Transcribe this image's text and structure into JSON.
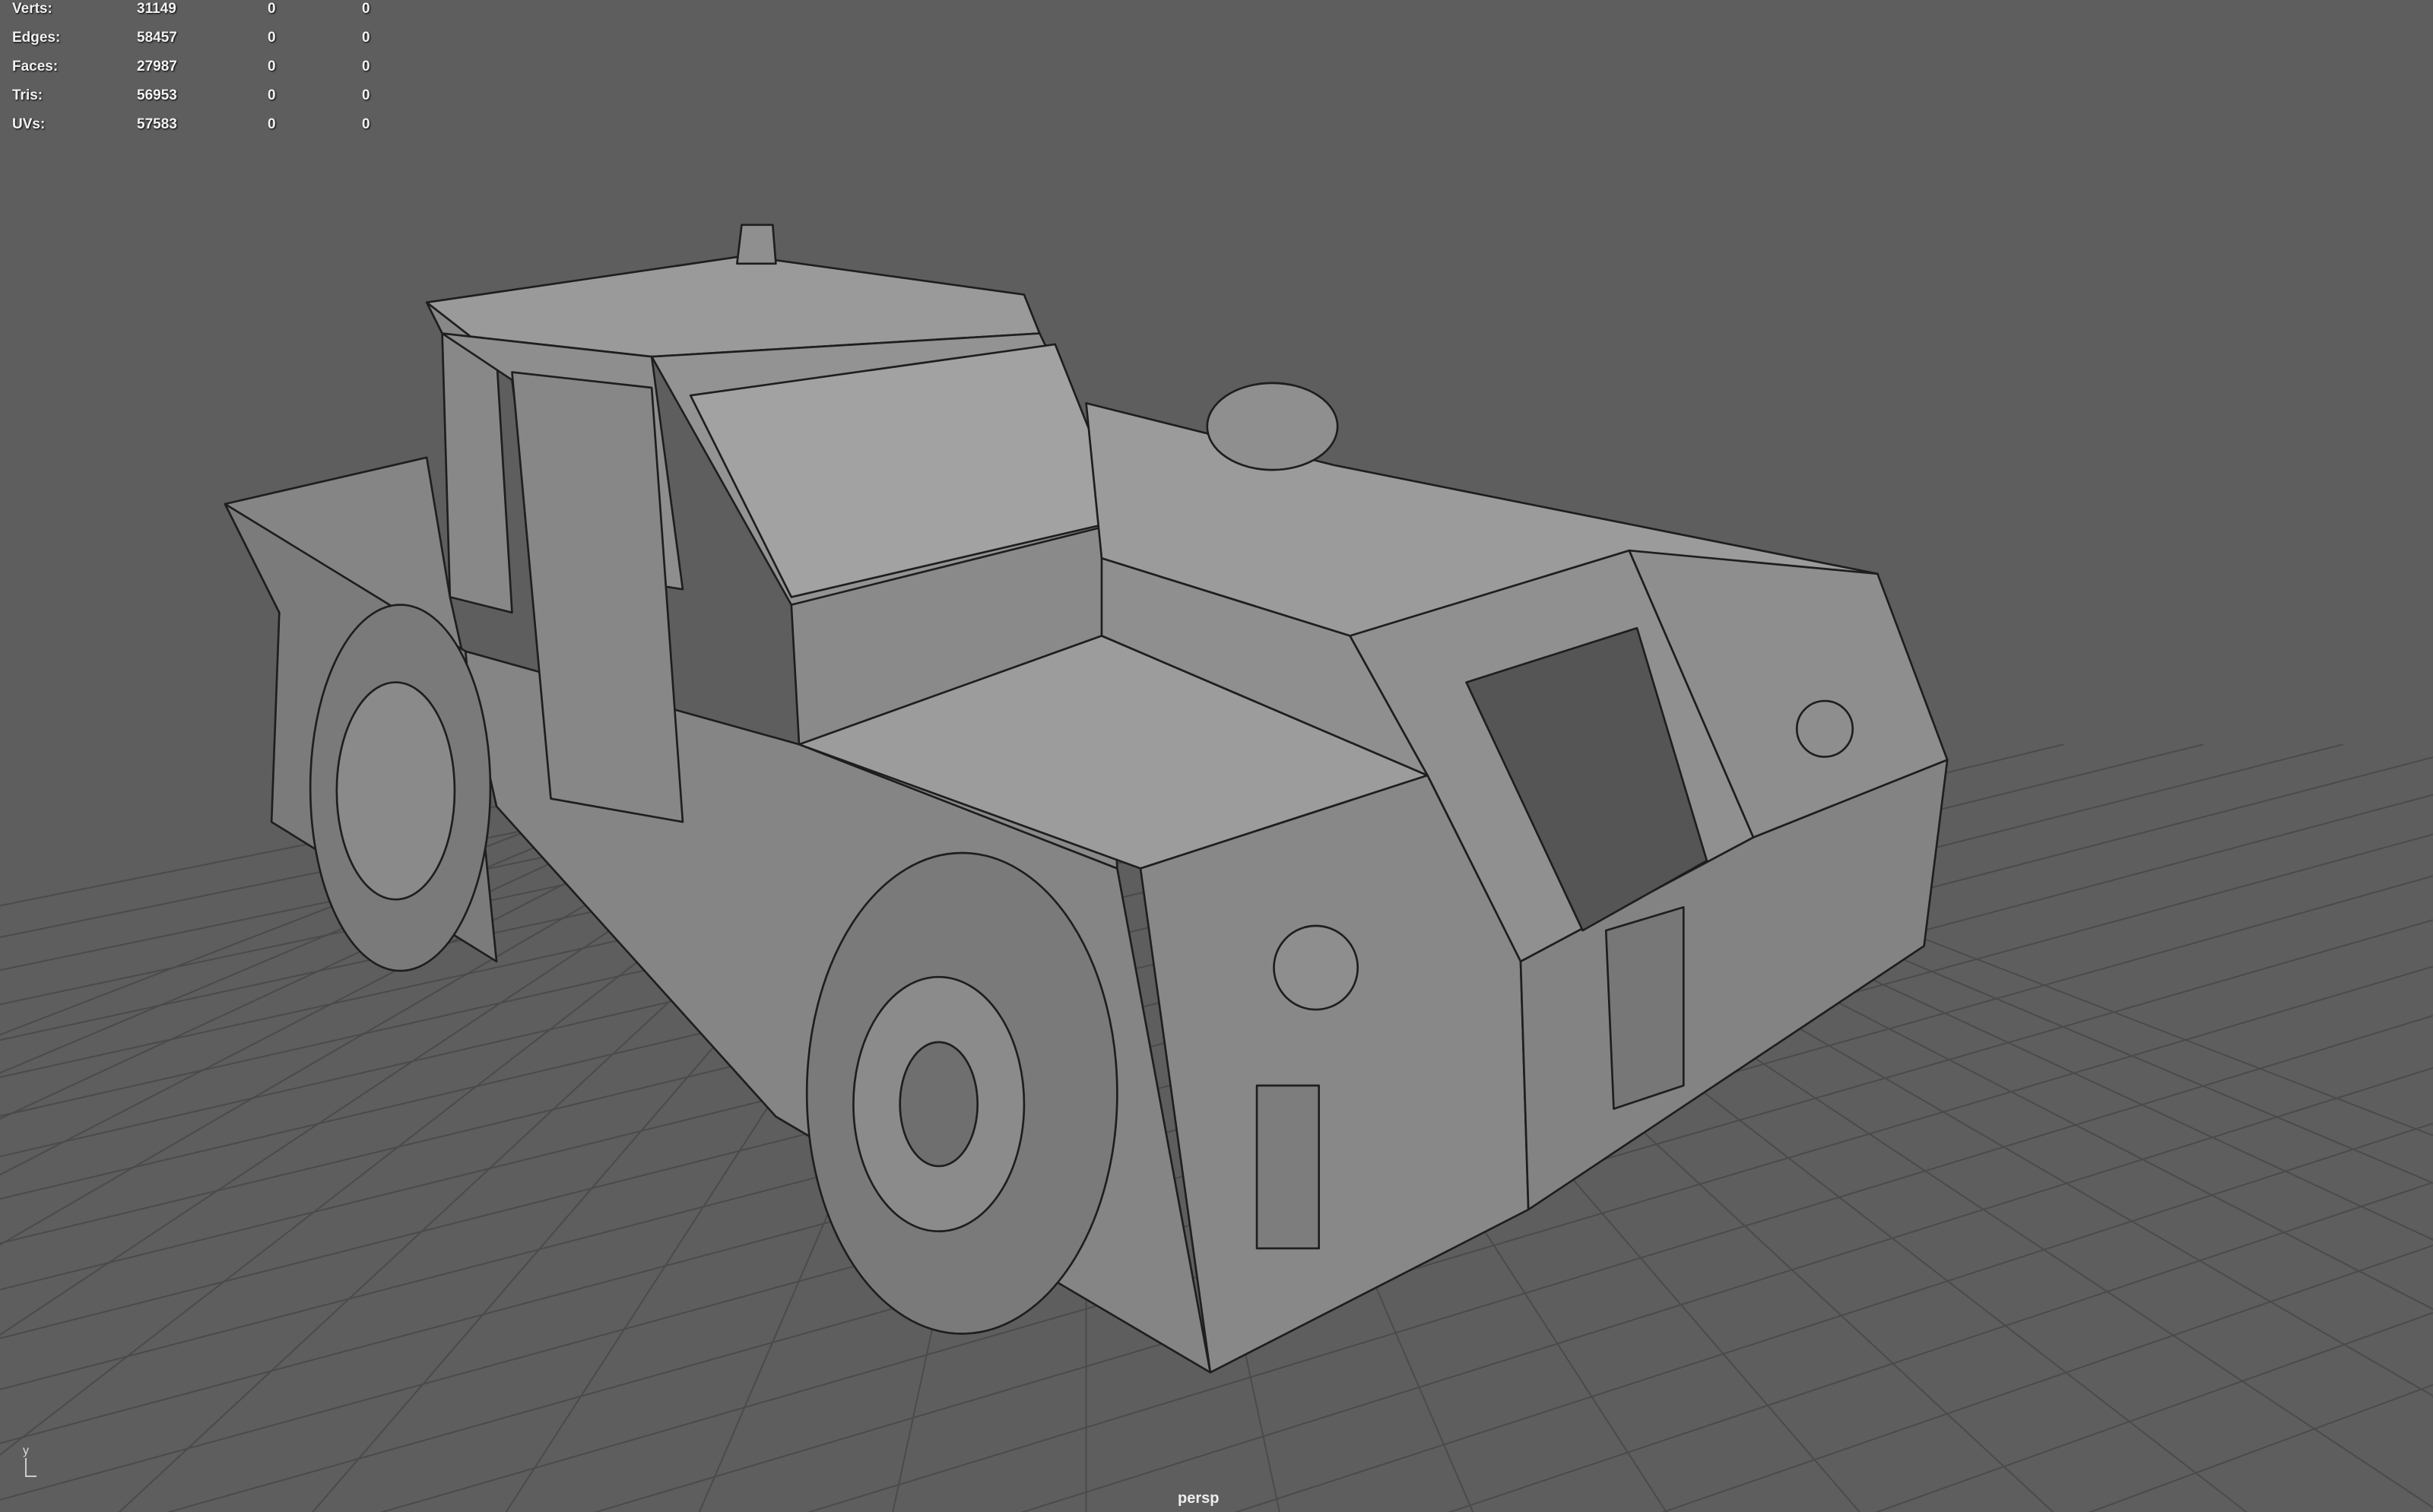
{
  "viewport": {
    "camera_label": "persp",
    "axis_label": "y"
  },
  "heads_up_display": {
    "rows": [
      {
        "label": "Verts:",
        "values": [
          "31149",
          "0",
          "0"
        ]
      },
      {
        "label": "Edges:",
        "values": [
          "58457",
          "0",
          "0"
        ]
      },
      {
        "label": "Faces:",
        "values": [
          "27987",
          "0",
          "0"
        ]
      },
      {
        "label": "Tris:",
        "values": [
          "56953",
          "0",
          "0"
        ]
      },
      {
        "label": "UVs:",
        "values": [
          "57583",
          "0",
          "0"
        ]
      }
    ]
  },
  "colors": {
    "background": "#5e5e5e",
    "mesh": "#8c8c8c",
    "wire": "#222222",
    "grid": "#4a4a4a"
  }
}
